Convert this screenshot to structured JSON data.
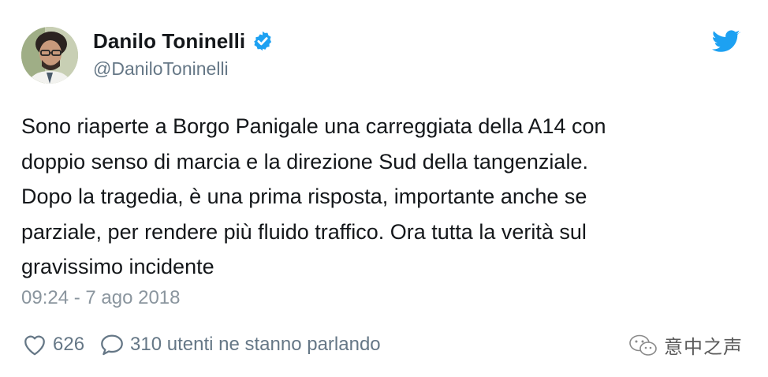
{
  "author": {
    "display_name": "Danilo Toninelli",
    "handle": "@DaniloToninelli",
    "verified": true
  },
  "tweet": {
    "text": "Sono riaperte a Borgo Panigale una carreggiata della A14 con\ndoppio senso di marcia e la direzione Sud della tangenziale.\nDopo la tragedia, è una prima risposta, importante anche se\nparziale, per rendere più fluido traffico. Ora tutta la verità sul\ngravissimo incidente",
    "timestamp": "09:24 - 7 ago 2018"
  },
  "actions": {
    "likes": "626",
    "replies_label": "310 utenti ne stanno parlando"
  },
  "watermark": {
    "label": "意中之声"
  },
  "icons": {
    "verified": "verified-badge-icon",
    "brand": "twitter-bird-icon",
    "like": "heart-icon",
    "reply": "speech-bubble-icon",
    "watermark": "wechat-icon"
  },
  "colors": {
    "twitter_blue": "#1da1f2",
    "text_primary": "#14171a",
    "text_secondary": "#657786",
    "timestamp": "#8a959e"
  }
}
